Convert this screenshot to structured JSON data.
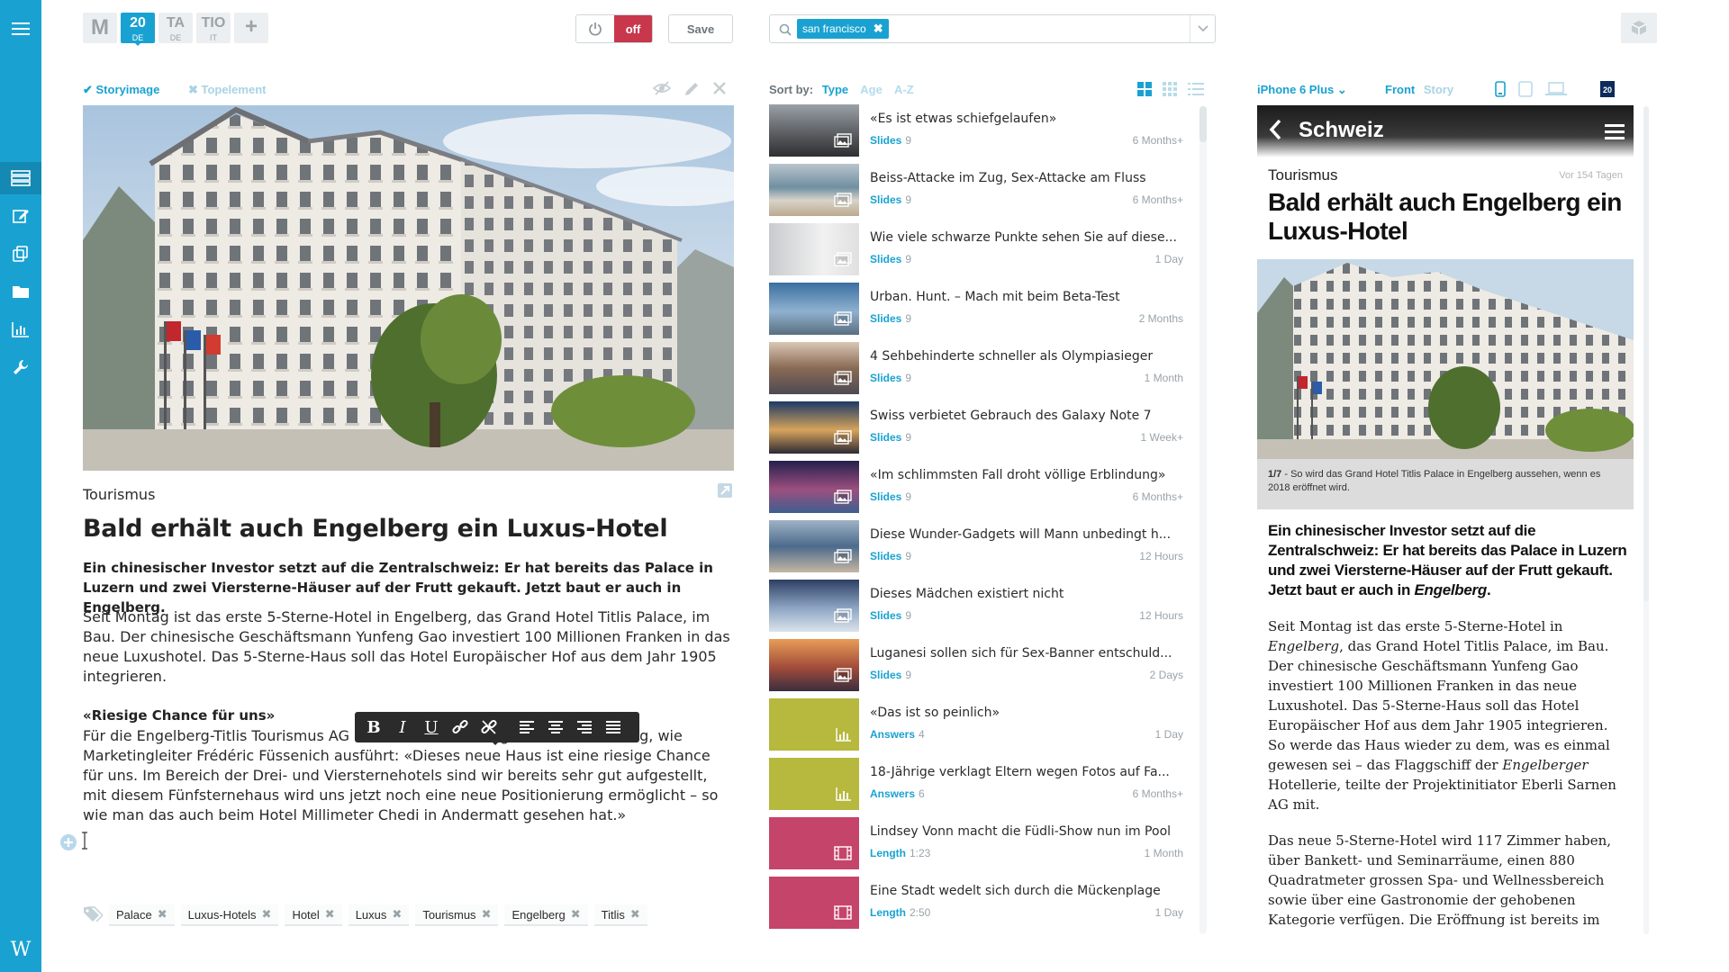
{
  "editions": [
    {
      "big": "M",
      "small": "",
      "active": false
    },
    {
      "big": "20",
      "small": "DE",
      "active": true
    },
    {
      "big": "TA",
      "small": "DE",
      "active": false
    },
    {
      "big": "TIO",
      "small": "IT",
      "active": false
    },
    {
      "big": "+",
      "small": "",
      "active": false
    }
  ],
  "toolbar": {
    "off_label": "off",
    "save_label": "Save"
  },
  "asset_tabs": {
    "storyimage": "Storyimage",
    "topelement": "Topelement"
  },
  "article": {
    "kicker": "Tourismus",
    "title": "Bald erhält auch Engelberg ein Luxus-Hotel",
    "lead": "Ein chinesischer Investor setzt auf die Zentralschweiz: Er hat bereits das Palace in Luzern und zwei Viersterne-Häuser auf der Frutt gekauft. Jetzt baut er auch in Engelberg.",
    "body1": "Seit Montag ist das erste 5-Sterne-Hotel in Engelberg, das Grand Hotel Titlis Palace, im Bau. Der chinesische Geschäftsmann Yunfeng Gao investiert 100 Millionen Franken in das neue Luxushotel. Das 5-Sterne-Haus soll das Hotel Europäischer Hof aus dem Jahr 1905 integrieren.",
    "subhead": "«Riesige Chance für uns»",
    "body2": "Für die Engelberg-Titlis Tourismus AG ist der Neubau eine grosse Bereicherung, wie Marketingleiter Frédéric Füssenich ausführt: «Dieses neue Haus ist eine riesige Chance für uns. Im Bereich der Drei- und Viersternehotels sind wir bereits sehr gut aufgestellt, mit diesem Fünfsternehaus wird uns jetzt noch eine neue Positionierung ermöglicht – so wie man das auch beim Hotel Millimeter Chedi in Andermatt gesehen hat.»"
  },
  "format_bar": [
    "B",
    "I",
    "U"
  ],
  "tags": [
    "Palace",
    "Luxus-Hotels",
    "Hotel",
    "Luxus",
    "Tourismus",
    "Engelberg",
    "Titlis"
  ],
  "search": {
    "chip": "san francisco"
  },
  "sort": {
    "label": "Sort by:",
    "options": [
      "Type",
      "Age",
      "A-Z"
    ]
  },
  "list_items": [
    {
      "title": "«Es ist etwas schiefgelaufen»",
      "type": "Slides",
      "count": "9",
      "age": "6 Months+",
      "thumb": "dusk",
      "kind": "gallery"
    },
    {
      "title": "Beiss-Attacke im Zug, Sex-Attacke am Fluss",
      "type": "Slides",
      "count": "9",
      "age": "6 Months+",
      "thumb": "sea",
      "kind": "gallery"
    },
    {
      "title": "Wie viele schwarze Punkte sehen Sie auf diese...",
      "type": "Slides",
      "count": "9",
      "age": "1 Day",
      "thumb": "fog",
      "kind": "gallery"
    },
    {
      "title": "Urban. Hunt. – Mach mit beim Beta-Test",
      "type": "Slides",
      "count": "9",
      "age": "2 Months",
      "thumb": "bridge",
      "kind": "gallery"
    },
    {
      "title": "4 Sehbehinderte schneller als Olympiasieger",
      "type": "Slides",
      "count": "9",
      "age": "1 Month",
      "thumb": "coast",
      "kind": "gallery"
    },
    {
      "title": "Swiss verbietet Gebrauch des Galaxy Note 7",
      "type": "Slides",
      "count": "9",
      "age": "1 Week+",
      "thumb": "sunset",
      "kind": "gallery"
    },
    {
      "title": "«Im schlimmsten Fall droht völlige Erblindung»",
      "type": "Slides",
      "count": "9",
      "age": "6 Months+",
      "thumb": "city",
      "kind": "gallery"
    },
    {
      "title": "Diese Wunder-Gadgets will Mann unbedingt h...",
      "type": "Slides",
      "count": "9",
      "age": "12 Hours",
      "thumb": "houses",
      "kind": "gallery"
    },
    {
      "title": "Dieses Mädchen existiert nicht",
      "type": "Slides",
      "count": "9",
      "age": "12 Hours",
      "thumb": "clouds",
      "kind": "gallery"
    },
    {
      "title": "Luganesi sollen sich für Sex-Banner entschuld...",
      "type": "Slides",
      "count": "9",
      "age": "2 Days",
      "thumb": "goldengate",
      "kind": "gallery"
    },
    {
      "title": "«Das ist so peinlich»",
      "type": "Answers",
      "count": "4",
      "age": "1 Day",
      "thumb": "olive",
      "kind": "poll"
    },
    {
      "title": "18-Jährige verklagt Eltern wegen Fotos auf Fa...",
      "type": "Answers",
      "count": "6",
      "age": "6 Months+",
      "thumb": "olive",
      "kind": "poll"
    },
    {
      "title": "Lindsey Vonn macht die Füdli-Show nun im Pool",
      "type": "Length",
      "count": "1:23",
      "age": "1 Month",
      "thumb": "rose",
      "kind": "video"
    },
    {
      "title": "Eine Stadt wedelt sich durch die Mückenplage",
      "type": "Length",
      "count": "2:50",
      "age": "1 Day",
      "thumb": "rose",
      "kind": "video"
    }
  ],
  "preview": {
    "device": "iPhone 6 Plus",
    "front": "Front",
    "story": "Story",
    "header_title": "Schweiz",
    "kicker": "Tourismus",
    "age": "Vor 154 Tagen",
    "title": "Bald erhält auch Engelberg ein Luxus-Hotel",
    "caption_num": "1/7",
    "caption": " - So wird das Grand Hotel Titlis Palace in Engelberg aussehen, wenn es 2018 eröffnet wird.",
    "lead_main": "Ein chinesischer Investor setzt auf die Zentralschweiz: Er hat bereits das Palace in Luzern und zwei Viersterne-Häuser auf der Frutt gekauft. Jetzt baut er auch in ",
    "lead_em": "Engelberg",
    "lead_end": ".",
    "body1_a": "Seit Montag ist das erste 5-Sterne-Hotel in ",
    "body1_em1": "Engelberg",
    "body1_b": ", das Grand Hotel Titlis Palace, im Bau. Der chinesische Geschäftsmann Yunfeng Gao investiert 100 Millionen Franken in das neue Luxushotel. Das 5-Sterne-Haus soll das Hotel Europäischer Hof aus dem Jahr 1905 integrieren. So werde das Haus wieder zu dem, was es einmal gewesen sei – das Flaggschiff der ",
    "body1_em2": "Engelberger",
    "body1_c": " Hotellerie, teilte der Projektinitiator Eberli Sarnen AG mit.",
    "body2": "Das neue 5-Sterne-Hotel wird 117 Zimmer haben, über Bankett- und Seminarräume, einen 880 Quadratmeter grossen Spa- und Wellnessbereich sowie über eine Gastronomie der gehobenen Kategorie verfügen. Die Eröffnung ist bereits im"
  },
  "colors": {
    "accent": "#19a2d1",
    "off_button": "#c9374d",
    "poll": "#b7b83e",
    "video": "#c5446a"
  }
}
